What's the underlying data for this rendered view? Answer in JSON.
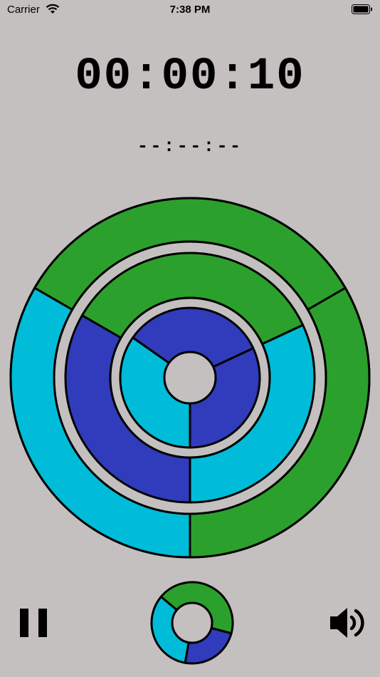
{
  "status_bar": {
    "carrier": "Carrier",
    "time": "7:38 PM",
    "wifi_icon": "wifi-icon",
    "battery_icon": "battery-icon"
  },
  "timer": {
    "elapsed": "00:00:10",
    "best": "--:--:--"
  },
  "colors": {
    "background": "#c4c0bf",
    "green": "#2ca02c",
    "cyan": "#00bcd8",
    "blue": "#303cbb",
    "gap": "#c4c0bf",
    "outline": "#000000"
  },
  "board": {
    "rings": [
      {
        "name": "outer",
        "segments": [
          {
            "start": 330,
            "end": 90,
            "color": "green"
          },
          {
            "start": 90,
            "end": 210,
            "color": "cyan"
          },
          {
            "start": 210,
            "end": 330,
            "color": "green"
          }
        ]
      },
      {
        "name": "middle",
        "segments": [
          {
            "start": 335,
            "end": 90,
            "color": "cyan"
          },
          {
            "start": 90,
            "end": 210,
            "color": "blue"
          },
          {
            "start": 210,
            "end": 335,
            "color": "green"
          }
        ]
      },
      {
        "name": "inner",
        "segments": [
          {
            "start": 335,
            "end": 90,
            "color": "blue"
          },
          {
            "start": 90,
            "end": 215,
            "color": "cyan"
          },
          {
            "start": 215,
            "end": 335,
            "color": "blue"
          }
        ]
      }
    ]
  },
  "next_piece": {
    "segments": [
      {
        "start": 15,
        "end": 100,
        "color": "blue"
      },
      {
        "start": 100,
        "end": 220,
        "color": "cyan"
      },
      {
        "start": 220,
        "end": 375,
        "color": "green"
      }
    ]
  },
  "controls": {
    "pause_icon": "pause-icon",
    "sound_icon": "speaker-icon"
  }
}
